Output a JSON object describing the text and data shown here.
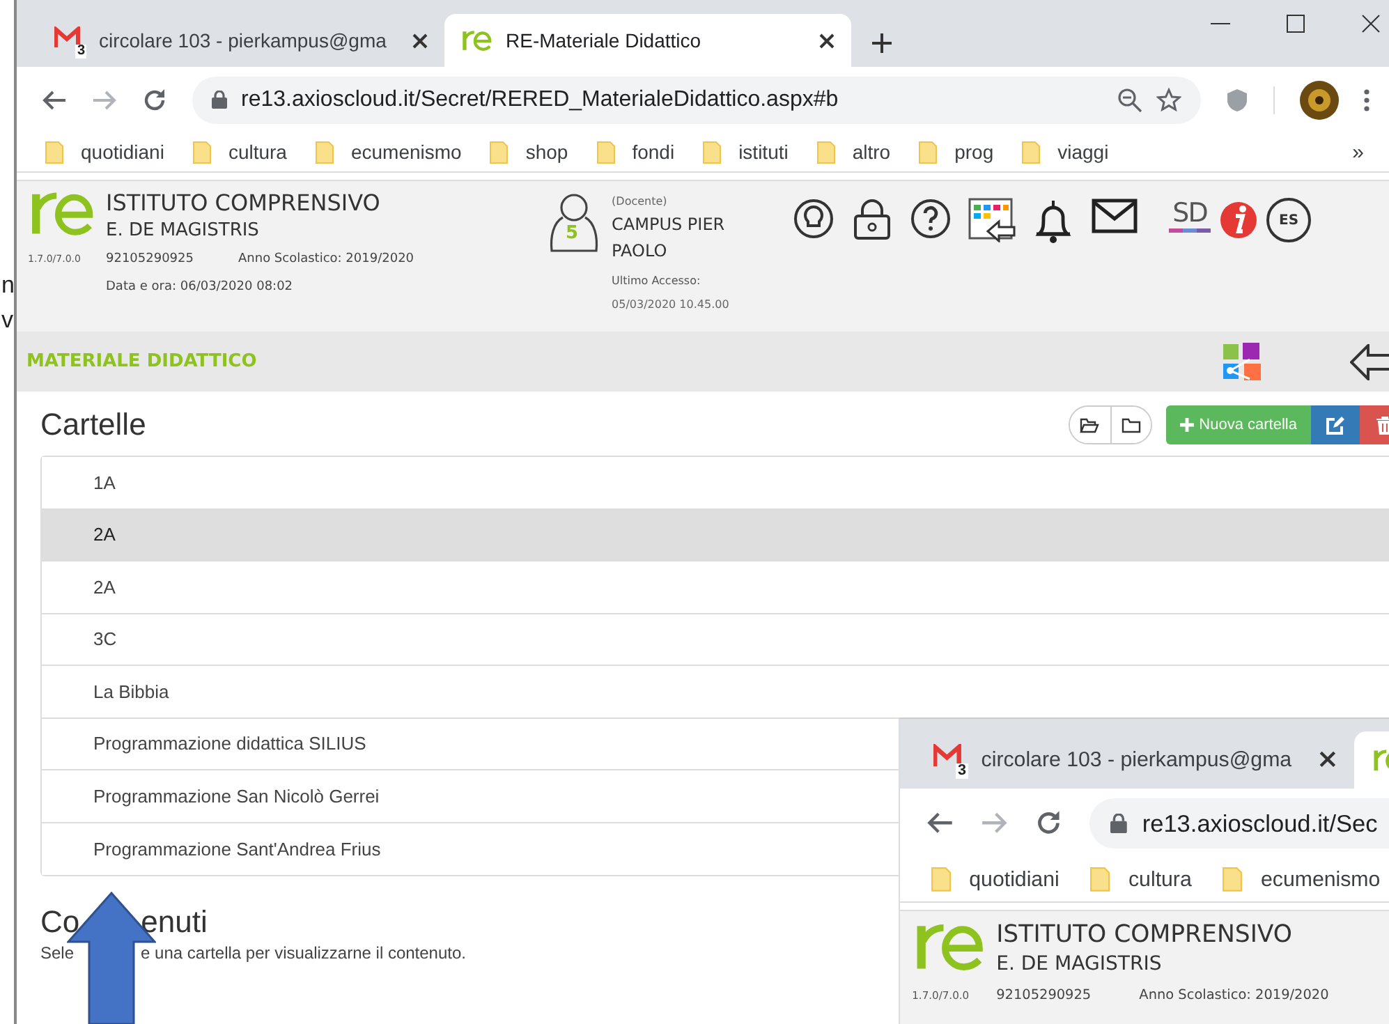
{
  "background_window": {
    "fragments": [
      "n",
      "v"
    ]
  },
  "browser": {
    "tabs": [
      {
        "kind": "mail",
        "badge": "3",
        "title": "circolare 103 - pierkampus@gma",
        "selected": false
      },
      {
        "kind": "re",
        "title": "RE-Materiale Didattico",
        "selected": true
      }
    ],
    "url": "re13.axioscloud.it/Secret/RERED_MaterialeDidattico.aspx#b",
    "bookmarks": [
      "quotidiani",
      "cultura",
      "ecumenismo",
      "shop",
      "fondi",
      "istituti",
      "altro",
      "prog",
      "viaggi"
    ],
    "bookmarks_overflow": "»"
  },
  "header": {
    "version": "1.7.0/7.0.0",
    "title": "ISTITUTO COMPRENSIVO",
    "subtitle": "E. DE MAGISTRIS",
    "code": "92105290925",
    "school_year": "Anno Scolastico: 2019/2020",
    "datetime": "Data e ora: 06/03/2020 08:02",
    "user": {
      "badge": "5",
      "role": "(Docente)",
      "name": "CAMPUS PIER PAOLO",
      "last_access_label": "Ultimo Accesso:",
      "last_access": "05/03/2020 10.45.00"
    },
    "sd_logo": "SD",
    "esc_label": "ES"
  },
  "page_title": "MATERIALE DIDATTICO",
  "folders": {
    "title": "Cartelle",
    "new_button": "Nuova cartella",
    "items": [
      {
        "name": "1A",
        "selected": false
      },
      {
        "name": "2A",
        "selected": true
      },
      {
        "name": "2A",
        "selected": false
      },
      {
        "name": "3C",
        "selected": false
      },
      {
        "name": "La Bibbia",
        "selected": false
      },
      {
        "name": "Programmazione didattica SILIUS",
        "selected": false
      },
      {
        "name": "Programmazione San Nicolò Gerrei",
        "selected": false
      },
      {
        "name": "Programmazione Sant'Andrea Frius",
        "selected": false
      }
    ]
  },
  "contents": {
    "title_parts": [
      "Co",
      "enuti"
    ],
    "hint_parts": [
      "Sele",
      "e una cartella per visualizzarne il contenuto."
    ]
  },
  "inset": {
    "browser": {
      "tabs": [
        {
          "kind": "mail",
          "badge": "3",
          "title": "circolare 103 - pierkampus@gma",
          "selected": false
        },
        {
          "kind": "re",
          "selected": true
        }
      ],
      "url": "re13.axioscloud.it/Sec",
      "bookmarks": [
        "quotidiani",
        "cultura",
        "ecumenismo"
      ]
    },
    "header": {
      "version": "1.7.0/7.0.0",
      "title": "ISTITUTO COMPRENSIVO",
      "subtitle": "E. DE MAGISTRIS",
      "code": "92105290925",
      "school_year": "Anno Scolastico: 2019/2020"
    }
  }
}
